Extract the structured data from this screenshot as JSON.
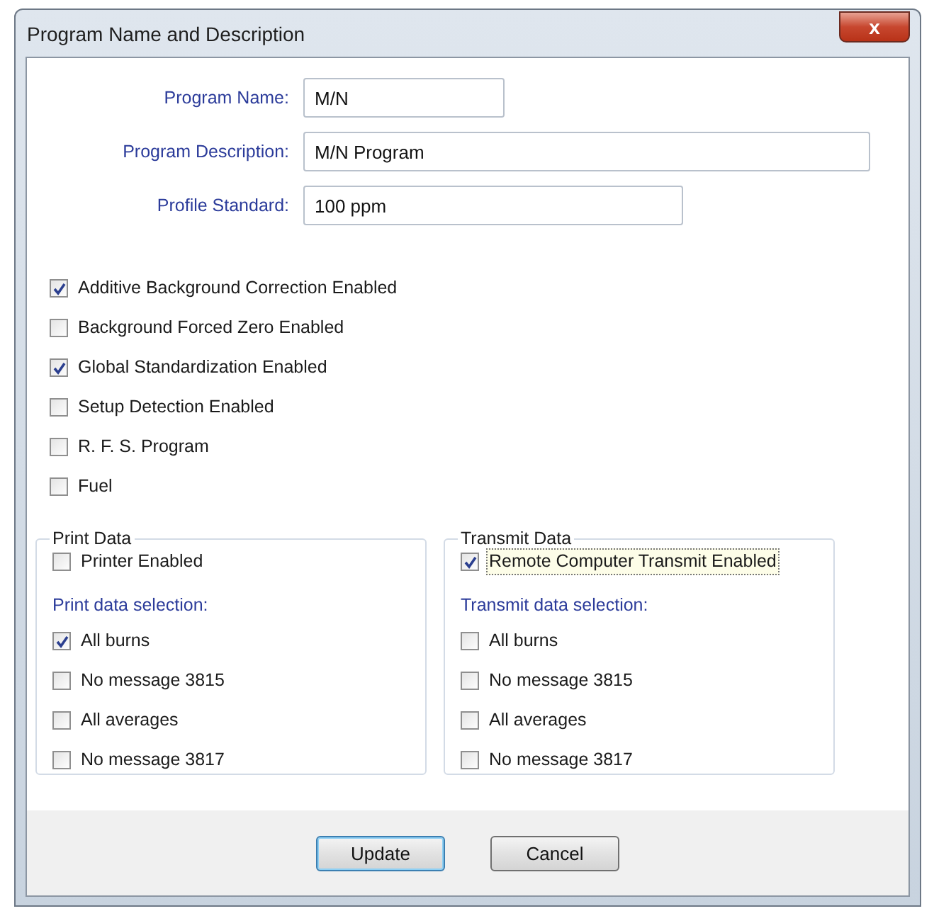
{
  "window": {
    "title": "Program Name and Description",
    "close_button": "x"
  },
  "fields": [
    {
      "label": "Program Name:",
      "value": "M/N"
    },
    {
      "label": "Program Description:",
      "value": "M/N Program"
    },
    {
      "label": "Profile Standard:",
      "value": "100 ppm"
    }
  ],
  "options": [
    {
      "label": "Additive Background Correction Enabled",
      "checked": true
    },
    {
      "label": "Background Forced Zero Enabled",
      "checked": false
    },
    {
      "label": "Global Standardization Enabled",
      "checked": true
    },
    {
      "label": "Setup Detection Enabled",
      "checked": false
    },
    {
      "label": "R. F. S. Program",
      "checked": false
    },
    {
      "label": "Fuel",
      "checked": false
    }
  ],
  "groups": [
    {
      "title": "Print Data",
      "enable": {
        "label": "Printer Enabled",
        "checked": false,
        "focused": false
      },
      "selection_title": "Print data selection:",
      "items": [
        {
          "label": "All burns",
          "checked": true
        },
        {
          "label": "No message 3815",
          "checked": false
        },
        {
          "label": "All averages",
          "checked": false
        },
        {
          "label": "No message 3817",
          "checked": false
        }
      ]
    },
    {
      "title": "Transmit Data",
      "enable": {
        "label": "Remote Computer Transmit Enabled",
        "checked": true,
        "focused": true
      },
      "selection_title": "Transmit data selection:",
      "items": [
        {
          "label": "All burns",
          "checked": false
        },
        {
          "label": "No message 3815",
          "checked": false
        },
        {
          "label": "All averages",
          "checked": false
        },
        {
          "label": "No message 3817",
          "checked": false
        }
      ]
    }
  ],
  "buttons": [
    {
      "label": "Update",
      "default": true
    },
    {
      "label": "Cancel",
      "default": false
    }
  ]
}
